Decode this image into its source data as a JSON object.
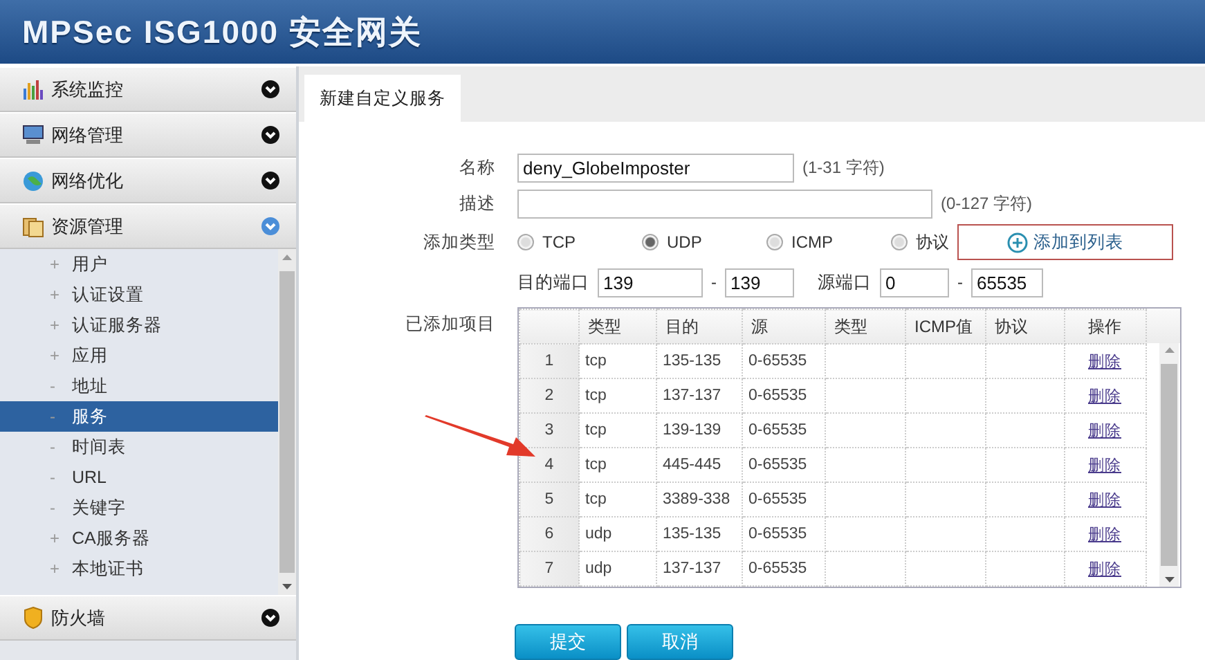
{
  "header": {
    "title": "MPSec ISG1000 安全网关"
  },
  "sidebar": {
    "groups": [
      {
        "label": "系统监控",
        "expanded": false
      },
      {
        "label": "网络管理",
        "expanded": false
      },
      {
        "label": "网络优化",
        "expanded": false
      },
      {
        "label": "资源管理",
        "expanded": true,
        "children": [
          {
            "marker": "+",
            "label": "用户",
            "selected": false
          },
          {
            "marker": "+",
            "label": "认证设置",
            "selected": false
          },
          {
            "marker": "+",
            "label": "认证服务器",
            "selected": false
          },
          {
            "marker": "+",
            "label": "应用",
            "selected": false
          },
          {
            "marker": "-",
            "label": "地址",
            "selected": false
          },
          {
            "marker": "-",
            "label": "服务",
            "selected": true
          },
          {
            "marker": "-",
            "label": "时间表",
            "selected": false
          },
          {
            "marker": "-",
            "label": "URL",
            "selected": false
          },
          {
            "marker": "-",
            "label": "关键字",
            "selected": false
          },
          {
            "marker": "+",
            "label": "CA服务器",
            "selected": false
          },
          {
            "marker": "+",
            "label": "本地证书",
            "selected": false
          }
        ]
      },
      {
        "label": "防火墙",
        "expanded": false
      }
    ]
  },
  "tabs": [
    {
      "label": "新建自定义服务",
      "selected": true
    }
  ],
  "form": {
    "name": {
      "label": "名称",
      "value": "deny_GlobeImposter",
      "hint": "(1-31 字符)"
    },
    "description": {
      "label": "描述",
      "hint": "(0-127 字符)"
    },
    "add_type": {
      "label": "添加类型",
      "options": [
        {
          "label": "TCP",
          "selected": false
        },
        {
          "label": "UDP",
          "selected": true
        },
        {
          "label": "ICMP",
          "selected": false
        },
        {
          "label": "协议",
          "selected": false
        }
      ],
      "add_button": "添加到列表"
    },
    "ports": {
      "dest_label": "目的端口",
      "dest_from": "139",
      "dest_separator": "-",
      "dest_to": "139",
      "src_label": "源端口",
      "src_from": "0",
      "src_separator": "-",
      "src_to": "65535"
    }
  },
  "added": {
    "label": "已添加项目",
    "columns": [
      "类型",
      "目的",
      "源",
      "类型",
      "ICMP值",
      "协议",
      "操作"
    ],
    "rows": [
      {
        "index": "1",
        "type": "tcp",
        "dest": "135-135",
        "source": "0-65535",
        "action": "删除"
      },
      {
        "index": "2",
        "type": "tcp",
        "dest": "137-137",
        "source": "0-65535",
        "action": "删除"
      },
      {
        "index": "3",
        "type": "tcp",
        "dest": "139-139",
        "source": "0-65535",
        "action": "删除"
      },
      {
        "index": "4",
        "type": "tcp",
        "dest": "445-445",
        "source": "0-65535",
        "action": "删除"
      },
      {
        "index": "5",
        "type": "tcp",
        "dest": "3389-338",
        "source": "0-65535",
        "action": "删除"
      },
      {
        "index": "6",
        "type": "udp",
        "dest": "135-135",
        "source": "0-65535",
        "action": "删除"
      },
      {
        "index": "7",
        "type": "udp",
        "dest": "137-137",
        "source": "0-65535",
        "action": "删除"
      }
    ]
  },
  "buttons": [
    {
      "label": "提交"
    },
    {
      "label": "取消"
    }
  ]
}
